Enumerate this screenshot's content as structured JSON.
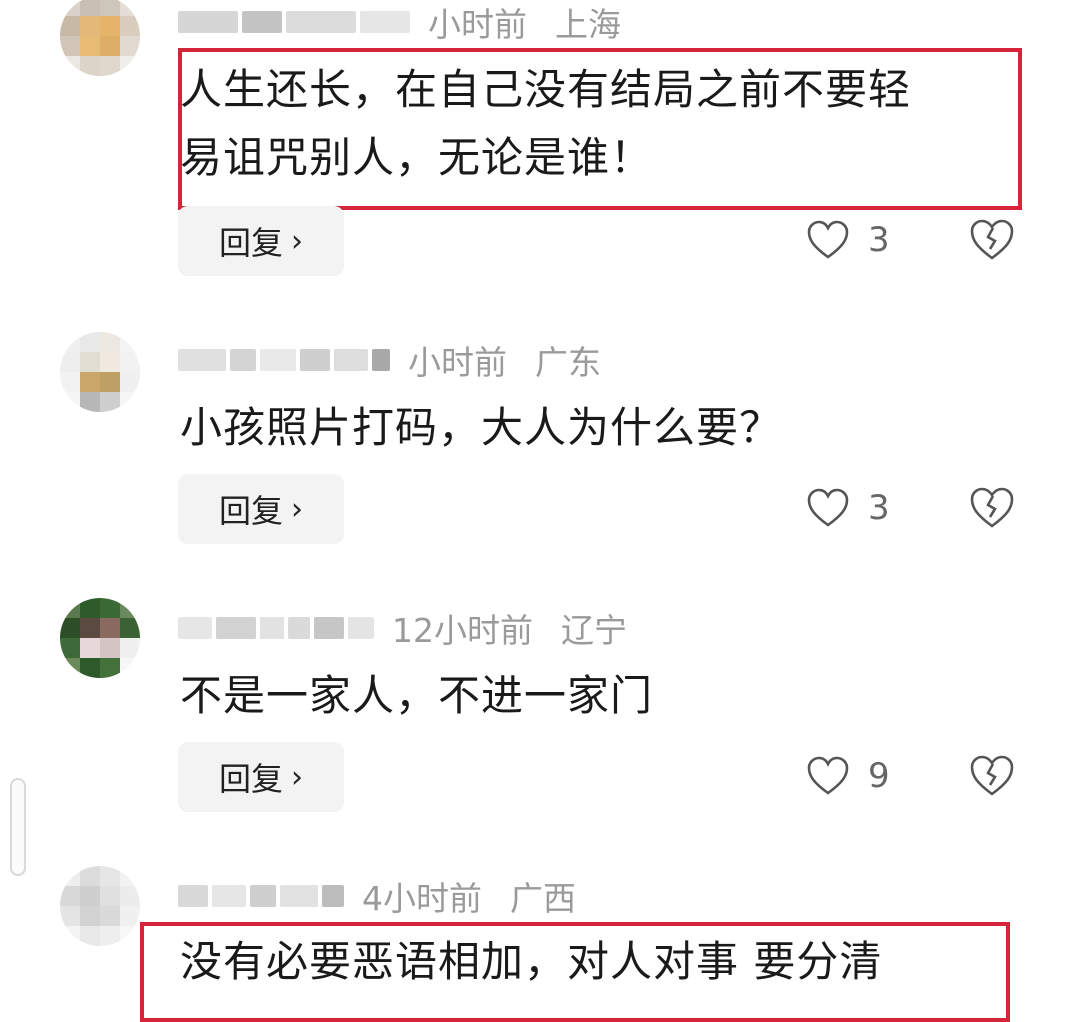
{
  "reply_label": "回复",
  "reply_chevron": "›",
  "highlight_color": "#d6243b",
  "comments": [
    {
      "time": "小时前",
      "location": "上海",
      "text_lines": [
        "人生还长，在自己没有结局之前不要轻",
        "易诅咒别人，无论是谁！"
      ],
      "likes": "3",
      "highlighted": true
    },
    {
      "time": "小时前",
      "location": "广东",
      "text_lines": [
        "小孩照片打码，大人为什么要？"
      ],
      "likes": "3",
      "highlighted": false
    },
    {
      "time": "12小时前",
      "location": "辽宁",
      "text_lines": [
        "不是一家人，不进一家门"
      ],
      "likes": "9",
      "highlighted": false
    },
    {
      "time": "4小时前",
      "location": "广西",
      "text_lines": [
        "没有必要恶语相加，对人对事 要分清"
      ],
      "likes": "",
      "highlighted": true
    }
  ]
}
